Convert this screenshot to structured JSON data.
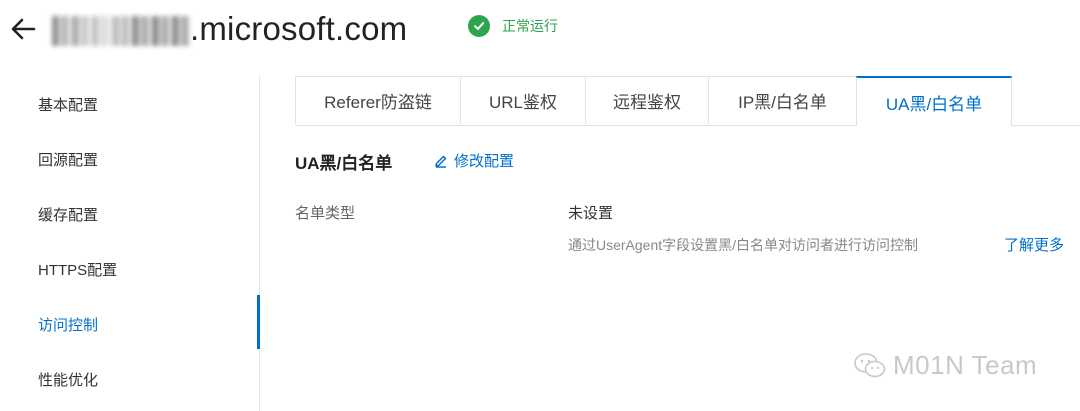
{
  "header": {
    "domain_suffix": ".microsoft.com",
    "status_text": "正常运行"
  },
  "sidebar": {
    "items": [
      {
        "label": "基本配置"
      },
      {
        "label": "回源配置"
      },
      {
        "label": "缓存配置"
      },
      {
        "label": "HTTPS配置"
      },
      {
        "label": "访问控制",
        "active": true
      },
      {
        "label": "性能优化"
      }
    ]
  },
  "tabs": [
    {
      "label": "Referer防盗链"
    },
    {
      "label": "URL鉴权"
    },
    {
      "label": "远程鉴权"
    },
    {
      "label": "IP黑/白名单"
    },
    {
      "label": "UA黑/白名单",
      "active": true
    }
  ],
  "section": {
    "title": "UA黑/白名单",
    "edit_label": "修改配置",
    "row_label": "名单类型",
    "row_value": "未设置",
    "description": "通过UserAgent字段设置黑/白名单对访问者进行访问控制",
    "learn_more": "了解更多"
  },
  "watermark": {
    "text": "M01N Team"
  },
  "colors": {
    "accent": "#0070cc",
    "success": "#2ea44f"
  },
  "icons": {
    "back": "arrow-left-icon",
    "status": "check-circle-icon",
    "edit": "pencil-icon",
    "watermark": "wechat-icon"
  }
}
